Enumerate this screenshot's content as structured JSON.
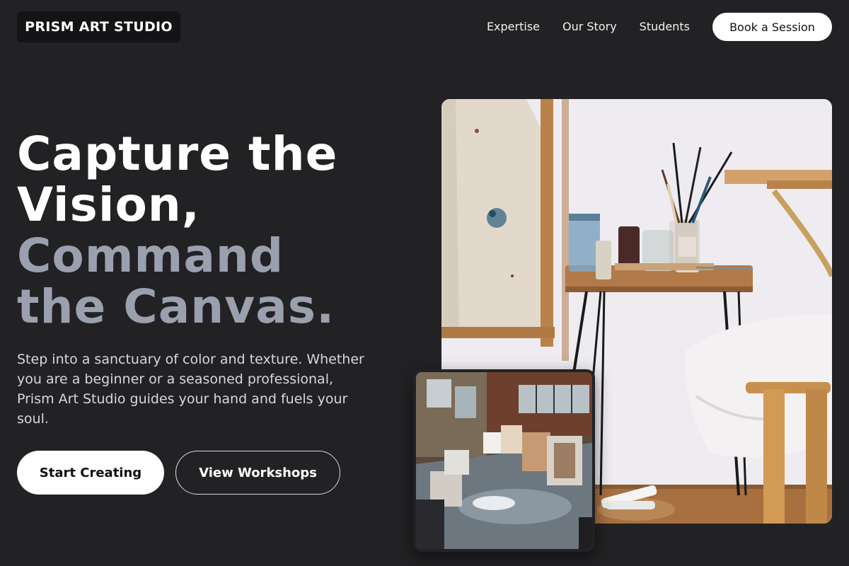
{
  "brand": {
    "logo_text": "PRISM ART STUDIO"
  },
  "nav": {
    "links": [
      {
        "label": "Expertise"
      },
      {
        "label": "Our Story"
      },
      {
        "label": "Students"
      }
    ],
    "cta_label": "Book a Session"
  },
  "hero": {
    "headline_lines": [
      "Capture the",
      "Vision,",
      "Command",
      "the Canvas."
    ],
    "subtitle": "Step into a sanctuary of color and texture. Whether you are a beginner or a seasoned professional, Prism Art Studio guides your hand and fuels your soul.",
    "primary_cta": "Start Creating",
    "secondary_cta": "View Workshops"
  },
  "images": {
    "main_alt": "Art studio corner with canvas, brushes in a jar and a wooden easel",
    "small_alt": "Messy painting studio floor with stacked canvases"
  },
  "colors": {
    "background": "#222224",
    "headline_muted": "#9aa0ae",
    "button_bg": "#ffffff"
  }
}
